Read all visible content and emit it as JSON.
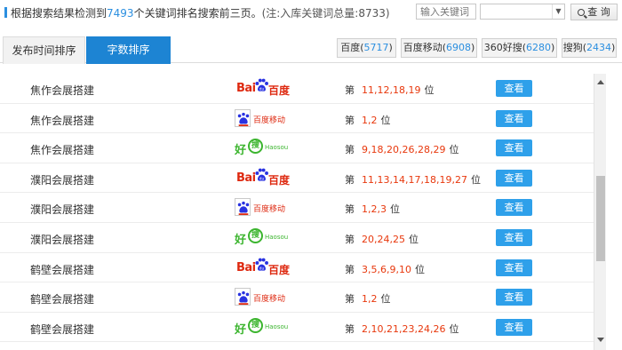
{
  "summary": {
    "prefix": "根据搜索结果检测到",
    "count": "7493",
    "suffix": "个关键词排名搜索前三页。",
    "note": "(注:入库关键词总量:8733)"
  },
  "search": {
    "placeholder": "输入关键词",
    "select_value": "",
    "button_label": "查 询"
  },
  "tabs": [
    {
      "label": "发布时间排序",
      "active": false
    },
    {
      "label": "字数排序",
      "active": true
    }
  ],
  "engines": [
    {
      "name": "百度",
      "count": "5717"
    },
    {
      "name": "百度移动",
      "count": "6908"
    },
    {
      "name": "360好搜",
      "count": "6280"
    },
    {
      "name": "搜狗",
      "count": "2434"
    }
  ],
  "logo_text": {
    "baidu_bai": "Bai",
    "baidu_du": "百度",
    "mobile": "百度移动",
    "haosou_hao": "好",
    "haosou_sou": "搜",
    "haosou_en": "Haosou"
  },
  "rank_labels": {
    "prefix": "第",
    "suffix": "位"
  },
  "view_label": "查看",
  "rows": [
    {
      "keyword": "焦作会展搭建",
      "engine": "baidu",
      "positions": "11,12,18,19"
    },
    {
      "keyword": "焦作会展搭建",
      "engine": "baidu-mobile",
      "positions": "1,2"
    },
    {
      "keyword": "焦作会展搭建",
      "engine": "haosou",
      "positions": "9,18,20,26,28,29"
    },
    {
      "keyword": "濮阳会展搭建",
      "engine": "baidu",
      "positions": "11,13,14,17,18,19,27"
    },
    {
      "keyword": "濮阳会展搭建",
      "engine": "baidu-mobile",
      "positions": "1,2,3"
    },
    {
      "keyword": "濮阳会展搭建",
      "engine": "haosou",
      "positions": "20,24,25"
    },
    {
      "keyword": "鹤壁会展搭建",
      "engine": "baidu",
      "positions": "3,5,6,9,10"
    },
    {
      "keyword": "鹤壁会展搭建",
      "engine": "baidu-mobile",
      "positions": "1,2"
    },
    {
      "keyword": "鹤壁会展搭建",
      "engine": "haosou",
      "positions": "2,10,21,23,24,26"
    }
  ],
  "colors": {
    "accent": "#1d84d3",
    "rank_red": "#e8380d",
    "baidu_red": "#de2910",
    "haosou_green": "#3cb52f"
  }
}
